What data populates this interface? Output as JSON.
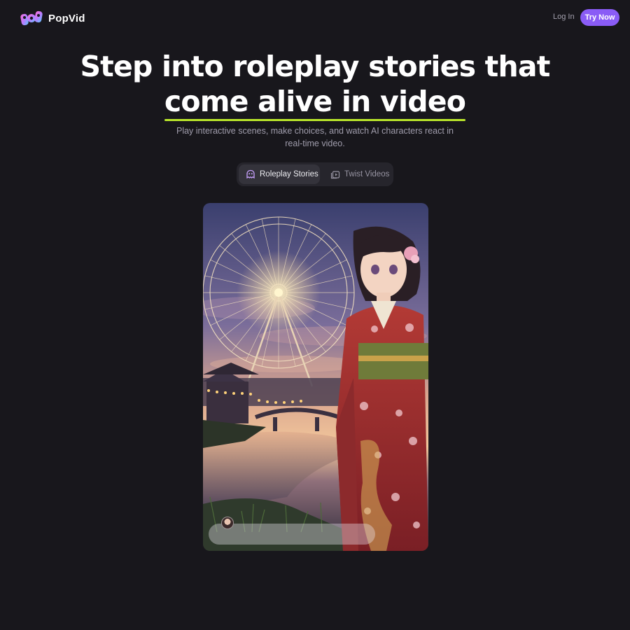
{
  "header": {
    "brand": "PopVid",
    "login_label": "Log In",
    "cta_label": "Try Now"
  },
  "hero": {
    "headline_line1": "Step into roleplay stories that",
    "headline_line2": "come alive in video",
    "subline_line1": "Play interactive scenes, make choices, and watch AI characters react in",
    "subline_line2": "real-time video."
  },
  "tabs": [
    {
      "label": "Roleplay Stories",
      "icon": "ghost-chat-icon",
      "active": true
    },
    {
      "label": "Twist Videos",
      "icon": "video-stack-icon",
      "active": false
    }
  ],
  "colors": {
    "background": "#18171c",
    "accent": "#8a5cf6",
    "underline": "#b9e52b"
  },
  "video": {
    "description_icon": "avatar",
    "chat_input_placeholder": ""
  }
}
